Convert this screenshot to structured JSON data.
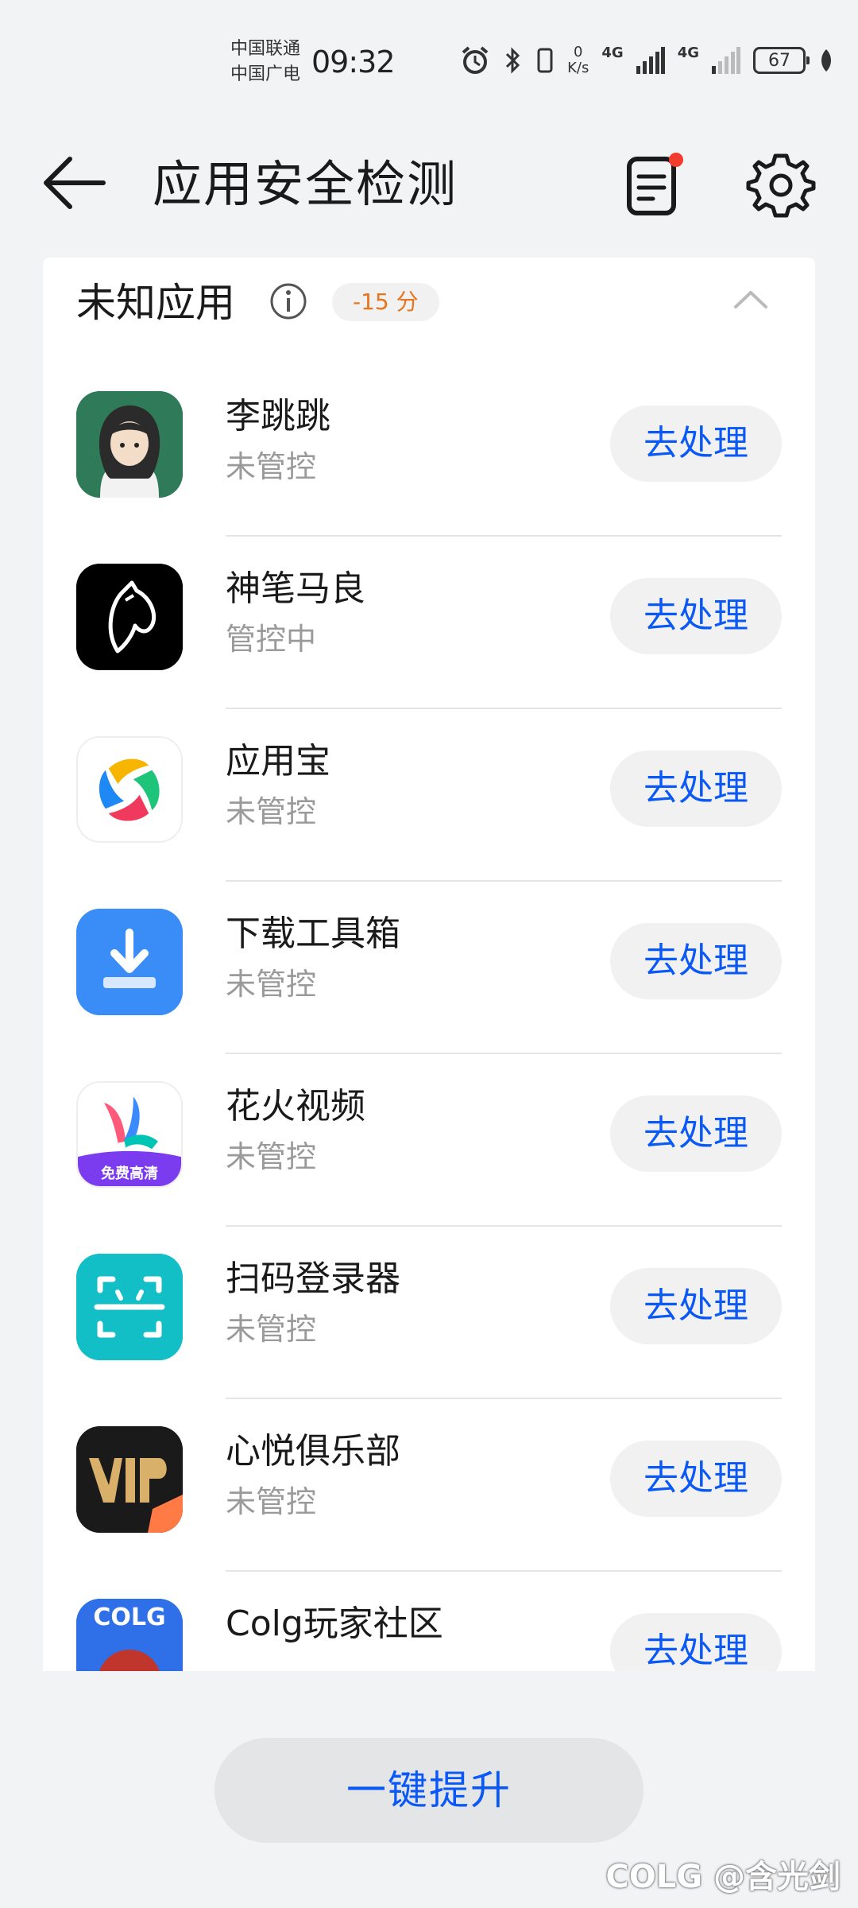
{
  "status_bar": {
    "carrier_1": "中国联通",
    "carrier_2": "中国广电",
    "time": "09:32",
    "net_speed_value": "0",
    "net_speed_unit": "K/s",
    "network_1": "4G",
    "network_2": "4G",
    "battery": "67",
    "icons": [
      "alarm-icon",
      "bluetooth-icon",
      "vibrate-icon",
      "signal-icon",
      "leaf-icon"
    ]
  },
  "header": {
    "title": "应用安全检测",
    "back_icon": "back-arrow-icon",
    "notes_icon": "notes-icon",
    "settings_icon": "gear-icon"
  },
  "section": {
    "title": "未知应用",
    "score": "-15 分"
  },
  "apps": [
    {
      "name": "李跳跳",
      "status": "未管控",
      "action": "去处理"
    },
    {
      "name": "神笔马良",
      "status": "管控中",
      "action": "去处理"
    },
    {
      "name": "应用宝",
      "status": "未管控",
      "action": "去处理"
    },
    {
      "name": "下载工具箱",
      "status": "未管控",
      "action": "去处理"
    },
    {
      "name": "花火视频",
      "status": "未管控",
      "action": "去处理"
    },
    {
      "name": "扫码登录器",
      "status": "未管控",
      "action": "去处理"
    },
    {
      "name": "心悦俱乐部",
      "status": "未管控",
      "action": "去处理"
    },
    {
      "name": "Colg玩家社区",
      "status": "",
      "action": "去处理"
    }
  ],
  "icon_text": {
    "huahuo_badge": "免费高清",
    "colg_logo": "COLG"
  },
  "footer": {
    "boost_button": "一键提升",
    "watermark": "COLG @含光剑"
  },
  "colors": {
    "accent": "#0a59f7",
    "score": "#e8741c",
    "notification_dot": "#f23c2e"
  }
}
